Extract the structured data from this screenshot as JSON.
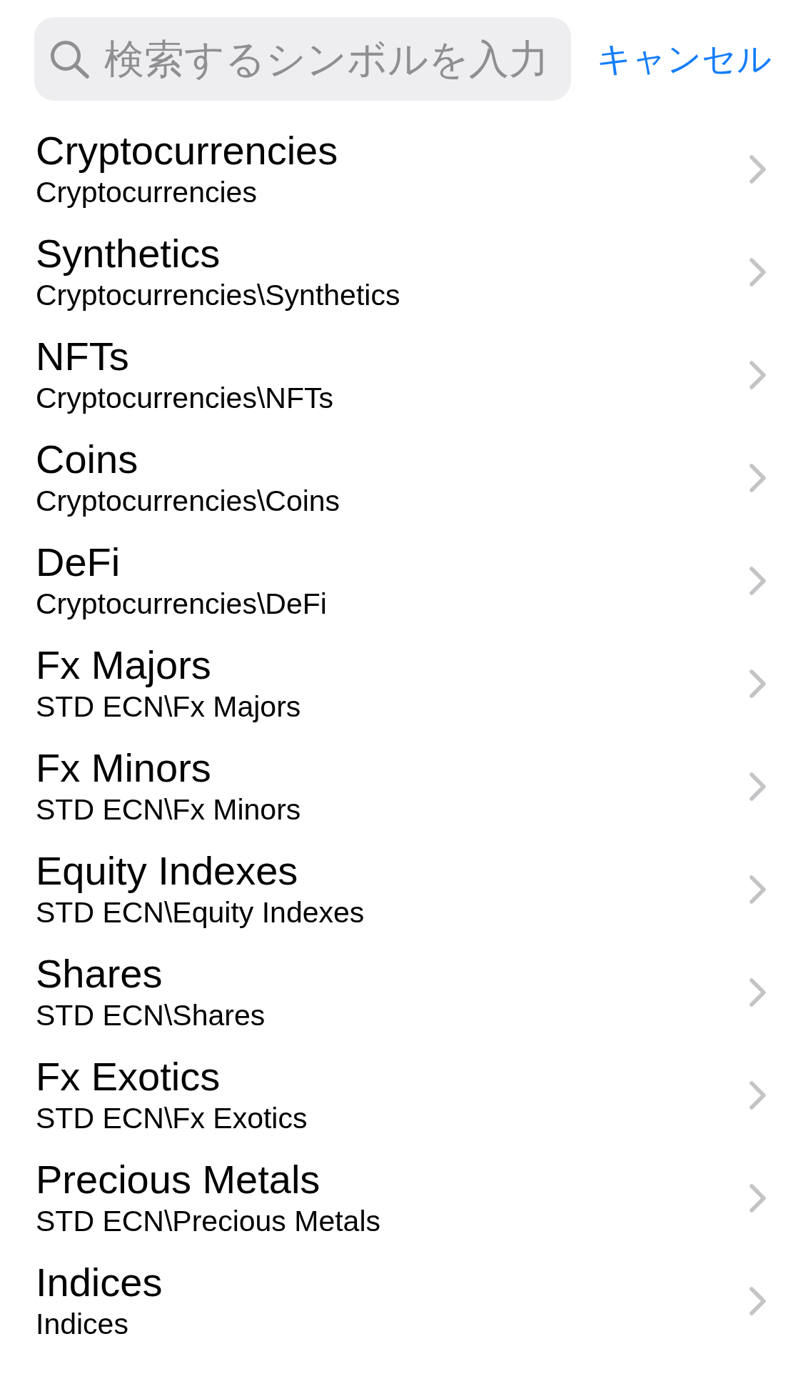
{
  "search": {
    "placeholder": "検索するシンボルを入力"
  },
  "cancel_button": "キャンセル",
  "items": [
    {
      "title": "Cryptocurrencies",
      "path": "Cryptocurrencies"
    },
    {
      "title": "Synthetics",
      "path": "Cryptocurrencies\\Synthetics"
    },
    {
      "title": "NFTs",
      "path": "Cryptocurrencies\\NFTs"
    },
    {
      "title": "Coins",
      "path": "Cryptocurrencies\\Coins"
    },
    {
      "title": "DeFi",
      "path": "Cryptocurrencies\\DeFi"
    },
    {
      "title": "Fx Majors",
      "path": "STD ECN\\Fx Majors"
    },
    {
      "title": "Fx Minors",
      "path": "STD ECN\\Fx Minors"
    },
    {
      "title": "Equity Indexes",
      "path": "STD ECN\\Equity Indexes"
    },
    {
      "title": "Shares",
      "path": "STD ECN\\Shares"
    },
    {
      "title": "Fx Exotics",
      "path": "STD ECN\\Fx Exotics"
    },
    {
      "title": "Precious Metals",
      "path": "STD ECN\\Precious Metals"
    },
    {
      "title": "Indices",
      "path": "Indices"
    }
  ]
}
